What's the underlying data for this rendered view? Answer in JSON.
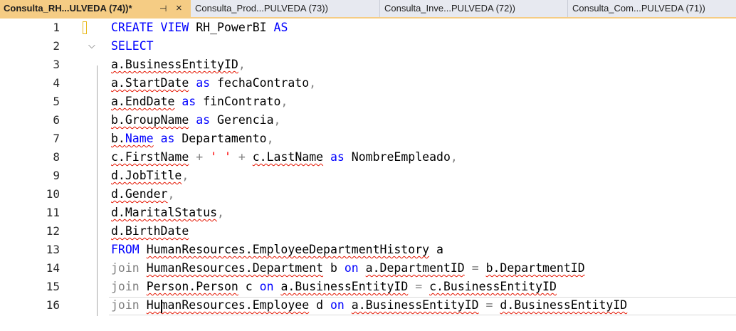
{
  "tabs": [
    {
      "label": "Consulta_RH...ULVEDA (74))*",
      "active": true,
      "pin": "⊣",
      "close": "×"
    },
    {
      "label": "Consulta_Prod...PULVEDA (73))"
    },
    {
      "label": "Consulta_Inve...PULVEDA (72))"
    },
    {
      "label": "Consulta_Com...PULVEDA (71))"
    }
  ],
  "editor": {
    "fold_icon": "chevron-down",
    "fold_glyph": "⌵",
    "current_line": 16,
    "colors": {
      "keyword": "#0000ff",
      "gray": "#808080",
      "string": "#ff0000",
      "squiggle": "#e51400",
      "active_tab": "#f5cc84"
    },
    "lines": [
      {
        "n": "1",
        "tokens": [
          {
            "t": "CREATE",
            "c": "kw"
          },
          {
            "t": " "
          },
          {
            "t": "VIEW",
            "c": "kw"
          },
          {
            "t": " RH_PowerBI "
          },
          {
            "t": "AS",
            "c": "kw"
          }
        ]
      },
      {
        "n": "2",
        "tokens": [
          {
            "t": "SELECT",
            "c": "kw"
          }
        ]
      },
      {
        "n": "3",
        "tokens": [
          {
            "t": "a.BusinessEntityID",
            "c": "sq"
          },
          {
            "t": ",",
            "c": "gray"
          }
        ]
      },
      {
        "n": "4",
        "tokens": [
          {
            "t": "a.StartDate",
            "c": "sq"
          },
          {
            "t": " "
          },
          {
            "t": "as",
            "c": "kw"
          },
          {
            "t": " fechaContrato"
          },
          {
            "t": ",",
            "c": "gray"
          }
        ]
      },
      {
        "n": "5",
        "tokens": [
          {
            "t": "a.EndDate",
            "c": "sq"
          },
          {
            "t": " "
          },
          {
            "t": "as",
            "c": "kw"
          },
          {
            "t": " finContrato"
          },
          {
            "t": ",",
            "c": "gray"
          }
        ]
      },
      {
        "n": "6",
        "tokens": [
          {
            "t": "b.GroupName",
            "c": "sq"
          },
          {
            "t": " "
          },
          {
            "t": "as",
            "c": "kw"
          },
          {
            "t": " Gerencia"
          },
          {
            "t": ",",
            "c": "gray"
          }
        ]
      },
      {
        "n": "7",
        "tokens": [
          {
            "t": "b.",
            "c": "sq"
          },
          {
            "t": "Name",
            "c": "kw sq"
          },
          {
            "t": " "
          },
          {
            "t": "as",
            "c": "kw"
          },
          {
            "t": " Departamento"
          },
          {
            "t": ",",
            "c": "gray"
          }
        ]
      },
      {
        "n": "8",
        "tokens": [
          {
            "t": "c.FirstName",
            "c": "sq"
          },
          {
            "t": " "
          },
          {
            "t": "+",
            "c": "gray"
          },
          {
            "t": " "
          },
          {
            "t": "' '",
            "c": "str"
          },
          {
            "t": " "
          },
          {
            "t": "+",
            "c": "gray"
          },
          {
            "t": " "
          },
          {
            "t": "c.LastName",
            "c": "sq"
          },
          {
            "t": " "
          },
          {
            "t": "as",
            "c": "kw"
          },
          {
            "t": " NombreEmpleado"
          },
          {
            "t": ",",
            "c": "gray"
          }
        ]
      },
      {
        "n": "9",
        "tokens": [
          {
            "t": "d.JobTitle",
            "c": "sq"
          },
          {
            "t": ",",
            "c": "gray"
          }
        ]
      },
      {
        "n": "10",
        "tokens": [
          {
            "t": "d.Gender",
            "c": "sq"
          },
          {
            "t": ",",
            "c": "gray"
          }
        ]
      },
      {
        "n": "11",
        "tokens": [
          {
            "t": "d.MaritalStatus",
            "c": "sq"
          },
          {
            "t": ",",
            "c": "gray"
          }
        ]
      },
      {
        "n": "12",
        "tokens": [
          {
            "t": "d.BirthDate",
            "c": "sq"
          }
        ]
      },
      {
        "n": "13",
        "tokens": [
          {
            "t": "FROM",
            "c": "kw"
          },
          {
            "t": " "
          },
          {
            "t": "HumanResources.EmployeeDepartmentHistory",
            "c": "sq"
          },
          {
            "t": " a"
          }
        ]
      },
      {
        "n": "14",
        "tokens": [
          {
            "t": "join",
            "c": "gray"
          },
          {
            "t": " "
          },
          {
            "t": "HumanResources.Department",
            "c": "sq"
          },
          {
            "t": " b "
          },
          {
            "t": "on",
            "c": "kw"
          },
          {
            "t": " "
          },
          {
            "t": "a.DepartmentID",
            "c": "sq"
          },
          {
            "t": " "
          },
          {
            "t": "=",
            "c": "gray"
          },
          {
            "t": " "
          },
          {
            "t": "b.DepartmentID",
            "c": "sq"
          }
        ]
      },
      {
        "n": "15",
        "tokens": [
          {
            "t": "join",
            "c": "gray"
          },
          {
            "t": " "
          },
          {
            "t": "Person.Person",
            "c": "sq"
          },
          {
            "t": " c "
          },
          {
            "t": "on",
            "c": "kw"
          },
          {
            "t": " "
          },
          {
            "t": "a.BusinessEntityID",
            "c": "sq"
          },
          {
            "t": " "
          },
          {
            "t": "=",
            "c": "gray"
          },
          {
            "t": " "
          },
          {
            "t": "c.BusinessEntityID",
            "c": "sq"
          }
        ]
      },
      {
        "n": "16",
        "tokens": [
          {
            "t": "join",
            "c": "gray"
          },
          {
            "t": " "
          },
          {
            "t": "HumanResources.Employee",
            "c": "sq"
          },
          {
            "t": " d "
          },
          {
            "t": "on",
            "c": "kw"
          },
          {
            "t": " "
          },
          {
            "t": "a.BusinessEntityID",
            "c": "sq"
          },
          {
            "t": " "
          },
          {
            "t": "=",
            "c": "gray"
          },
          {
            "t": " "
          },
          {
            "t": "d.BusinessEntityID",
            "c": "sq"
          }
        ]
      }
    ]
  }
}
